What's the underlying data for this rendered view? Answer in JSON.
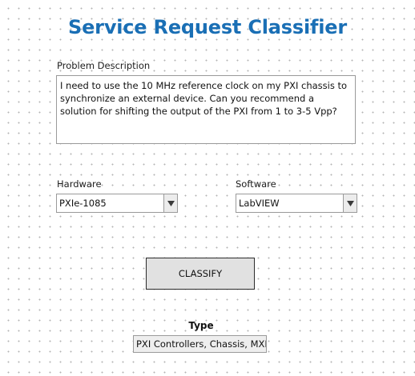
{
  "window": {
    "title": "Service Request Classifier",
    "title_color": "#1a6fb5"
  },
  "problem_description": {
    "label": "Problem Description",
    "value": "I need to use the 10 MHz reference clock on my PXI chassis to synchronize an external device. Can you recommend a solution for shifting the output of the PXI from 1 to 3-5 Vpp?"
  },
  "hardware": {
    "label": "Hardware",
    "selected": "PXIe-1085",
    "icon": "dropdown-arrow-icon"
  },
  "software": {
    "label": "Software",
    "selected": "LabVIEW",
    "icon": "dropdown-arrow-icon"
  },
  "classify_button": {
    "label": "CLASSIFY"
  },
  "type": {
    "label": "Type",
    "value": "PXI Controllers, Chassis, MXI"
  }
}
